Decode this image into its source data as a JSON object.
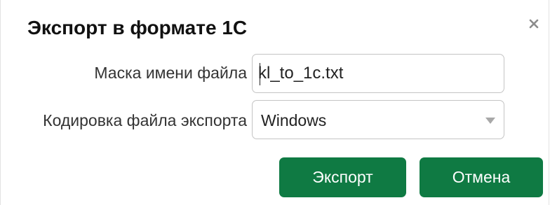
{
  "dialog": {
    "title": "Экспорт в формате 1С",
    "close_icon": "close-icon"
  },
  "form": {
    "mask_label": "Маска имени файла",
    "mask_value": "kl_to_1c.txt",
    "encoding_label": "Кодировка файла экспорта",
    "encoding_value": "Windows",
    "encoding_arrow_icon": "chevron-down-icon"
  },
  "buttons": {
    "export_label": "Экспорт",
    "cancel_label": "Отмена"
  },
  "colors": {
    "button_bg": "#0f7a43",
    "button_text": "#ffffff",
    "title_text": "#111111",
    "border": "#c4c4c4"
  }
}
